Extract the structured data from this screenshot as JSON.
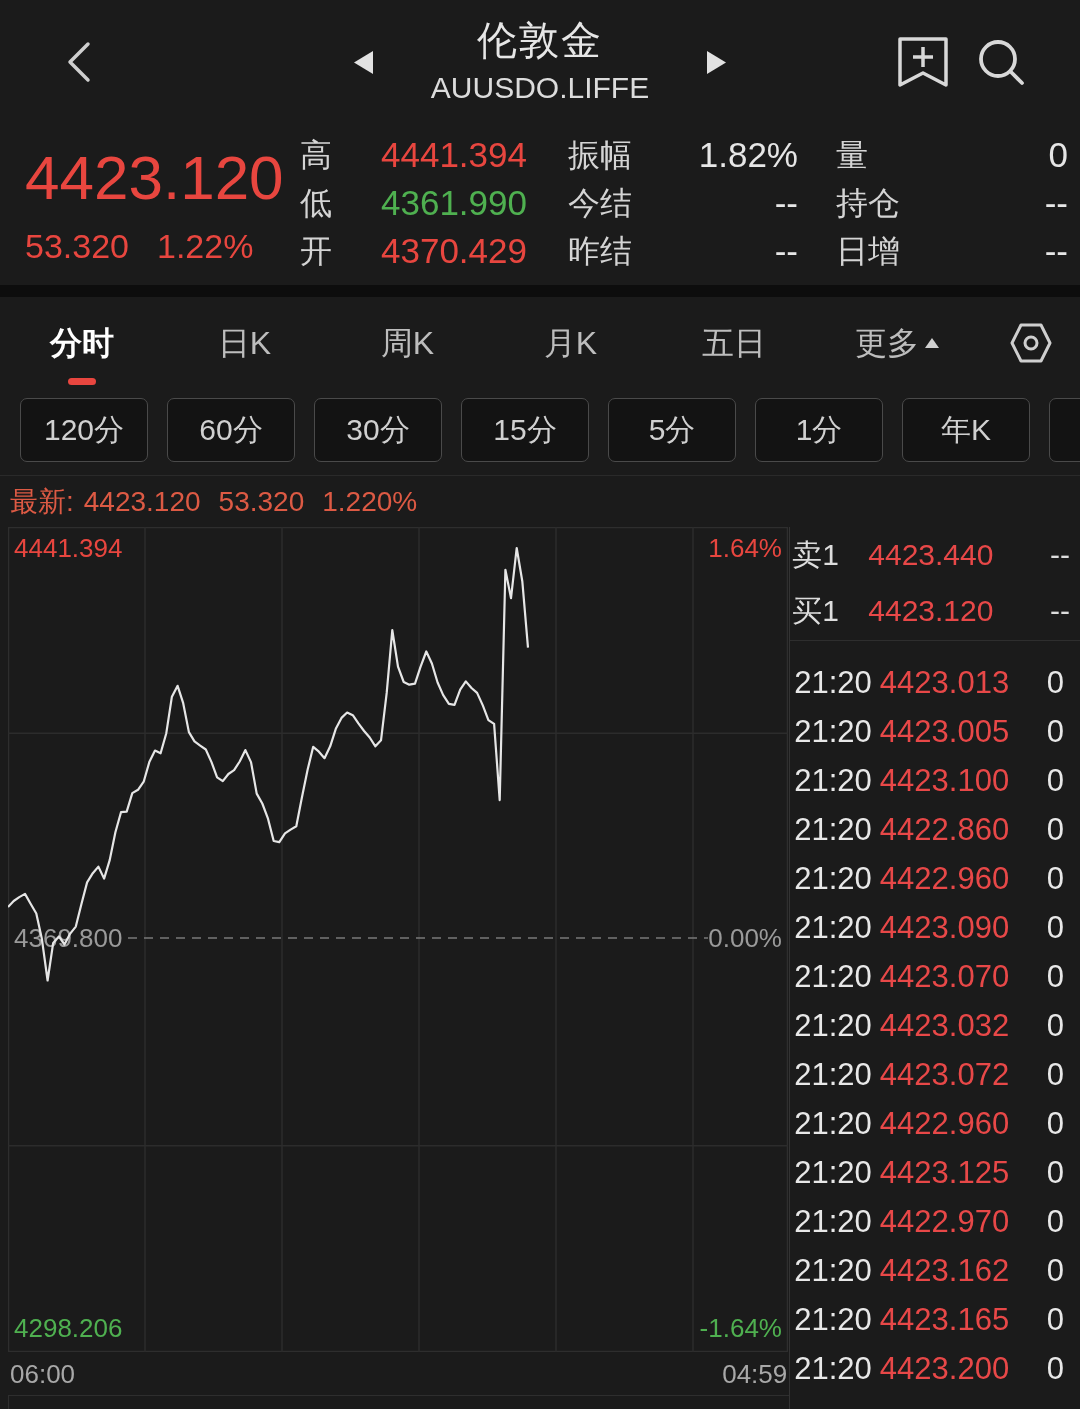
{
  "header": {
    "title": "伦敦金",
    "subtitle": "AUUSDO.LIFFE"
  },
  "quote": {
    "price": "4423.120",
    "change": "53.320",
    "change_percent": "1.22%",
    "stats": [
      {
        "label": "高",
        "value": "4441.394",
        "color": "#e8463f"
      },
      {
        "label": "振幅",
        "value": "1.82%",
        "color": "#e6e6e6"
      },
      {
        "label": "量",
        "value": "0",
        "color": "#e6e6e6"
      },
      {
        "label": "低",
        "value": "4361.990",
        "color": "#4fb050"
      },
      {
        "label": "今结",
        "value": "--",
        "color": "#e6e6e6"
      },
      {
        "label": "持仓",
        "value": "--",
        "color": "#e6e6e6"
      },
      {
        "label": "开",
        "value": "4370.429",
        "color": "#e8463f"
      },
      {
        "label": "昨结",
        "value": "--",
        "color": "#e6e6e6"
      },
      {
        "label": "日增",
        "value": "--",
        "color": "#e6e6e6"
      }
    ]
  },
  "tabs": [
    {
      "label": "分时",
      "selected": true,
      "kind": "tab"
    },
    {
      "label": "日K",
      "selected": false,
      "kind": "tab"
    },
    {
      "label": "周K",
      "selected": false,
      "kind": "tab"
    },
    {
      "label": "月K",
      "selected": false,
      "kind": "tab"
    },
    {
      "label": "五日",
      "selected": false,
      "kind": "tab"
    },
    {
      "label": "更多",
      "selected": false,
      "kind": "menu"
    }
  ],
  "intervals": {
    "buttons": [
      "120分",
      "60分",
      "30分",
      "15分",
      "5分",
      "1分",
      "年K"
    ],
    "clipped_more": true
  },
  "latest": {
    "label": "最新:",
    "price": "4423.120",
    "change": "53.320",
    "change_percent": "1.220%"
  },
  "chart": {
    "chart_data": {
      "type": "line",
      "categories": [
        null,
        null,
        null,
        null,
        null,
        null,
        null,
        null,
        null,
        null,
        null,
        null,
        null,
        null,
        null,
        null,
        null,
        null,
        null,
        null,
        null,
        null,
        null,
        null,
        null,
        null,
        null,
        null,
        null,
        null,
        null,
        null,
        null,
        null,
        null,
        null,
        null,
        null,
        null,
        null,
        null,
        null,
        null,
        null,
        null,
        null,
        null,
        null,
        null,
        null,
        null,
        null,
        null,
        null,
        null,
        null,
        null,
        null,
        null,
        null,
        null,
        null,
        null,
        null,
        null,
        null,
        null,
        null,
        null,
        null,
        null,
        null,
        null,
        null,
        null,
        null,
        null,
        null,
        null,
        null,
        null,
        null,
        null,
        null,
        null,
        null,
        null,
        null,
        null,
        null,
        null,
        null,
        null,
        null,
        null,
        null,
        null,
        null,
        null,
        null,
        null,
        null,
        null,
        null,
        null,
        null,
        null,
        null,
        null,
        null,
        null,
        null,
        null,
        null,
        null,
        null,
        null,
        null,
        null,
        null,
        null,
        null,
        null,
        null,
        null,
        null,
        null,
        null,
        null,
        null,
        null,
        null,
        null,
        null,
        null,
        null,
        null,
        null,
        null
      ],
      "series": [
        {
          "color": "#e6e6e6",
          "values": [
            4375.5,
            4376.6,
            4377.3,
            4377.9,
            4376.1,
            4374.3,
            4369.6,
            4362.0,
            4368.9,
            4370.1,
            4368.6,
            4370.6,
            4371.9,
            4376.1,
            4380.0,
            4381.7,
            4382.9,
            4380.7,
            4384.1,
            4389.2,
            4392.9,
            4393.0,
            4396.4,
            4397.0,
            4398.5,
            4402.1,
            4404.2,
            4403.7,
            4407.4,
            4414.1,
            4416.1,
            4412.9,
            4407.6,
            4405.9,
            4405.1,
            4404.4,
            4402.1,
            4399.3,
            4398.6,
            4399.9,
            4400.6,
            4402.2,
            4404.3,
            4402.1,
            4396.3,
            4394.5,
            4391.7,
            4387.6,
            4387.4,
            4389.0,
            4389.7,
            4390.3,
            4395.6,
            4400.7,
            4404.9,
            4404.0,
            4402.8,
            4405.0,
            4408.2,
            4410.2,
            4411.2,
            4410.7,
            4409.2,
            4407.8,
            4406.6,
            4405.0,
            4406.1,
            4414.8,
            4426.3,
            4419.6,
            4416.8,
            4416.3,
            4416.5,
            4419.6,
            4422.4,
            4420.2,
            4416.7,
            4414.4,
            4412.8,
            4412.6,
            4415.4,
            4416.9,
            4415.7,
            4414.8,
            4412.5,
            4409.8,
            4409.1,
            4395.1,
            4437.4,
            4432.2,
            4441.4,
            4435.3,
            4423.1,
            null,
            null,
            null,
            null,
            null,
            null,
            null,
            null,
            null,
            null,
            null,
            null,
            null,
            null,
            null,
            null,
            null,
            null,
            null,
            null,
            null,
            null,
            null,
            null,
            null,
            null,
            null,
            null,
            null,
            null,
            null,
            null,
            null,
            null,
            null,
            null,
            null,
            null,
            null,
            null,
            null,
            null,
            null,
            null,
            null,
            null
          ]
        }
      ],
      "ylim": [
        4293.8,
        4445.25
      ],
      "yticks": [
        {
          "value": 4441.394,
          "label": "4441.394"
        },
        {
          "value": 4369.8,
          "label": "4369.800"
        },
        {
          "value": 4298.206,
          "label": "4298.206"
        }
      ]
    },
    "percent_labels": [
      "1.64%",
      "0.00%",
      "-1.64%"
    ],
    "time_labels": [
      "06:00",
      "04:59"
    ]
  },
  "order_book": [
    {
      "label": "卖1",
      "price": "4423.440",
      "volume": "--"
    },
    {
      "label": "买1",
      "price": "4423.120",
      "volume": "--"
    }
  ],
  "trades": [
    {
      "time": "21:20",
      "price": "4423.013",
      "volume": "0"
    },
    {
      "time": "21:20",
      "price": "4423.005",
      "volume": "0"
    },
    {
      "time": "21:20",
      "price": "4423.100",
      "volume": "0"
    },
    {
      "time": "21:20",
      "price": "4422.860",
      "volume": "0"
    },
    {
      "time": "21:20",
      "price": "4422.960",
      "volume": "0"
    },
    {
      "time": "21:20",
      "price": "4423.090",
      "volume": "0"
    },
    {
      "time": "21:20",
      "price": "4423.070",
      "volume": "0"
    },
    {
      "time": "21:20",
      "price": "4423.032",
      "volume": "0"
    },
    {
      "time": "21:20",
      "price": "4423.072",
      "volume": "0"
    },
    {
      "time": "21:20",
      "price": "4422.960",
      "volume": "0"
    },
    {
      "time": "21:20",
      "price": "4423.125",
      "volume": "0"
    },
    {
      "time": "21:20",
      "price": "4422.970",
      "volume": "0"
    },
    {
      "time": "21:20",
      "price": "4423.162",
      "volume": "0"
    },
    {
      "time": "21:20",
      "price": "4423.165",
      "volume": "0"
    },
    {
      "time": "21:20",
      "price": "4423.200",
      "volume": "0"
    }
  ]
}
